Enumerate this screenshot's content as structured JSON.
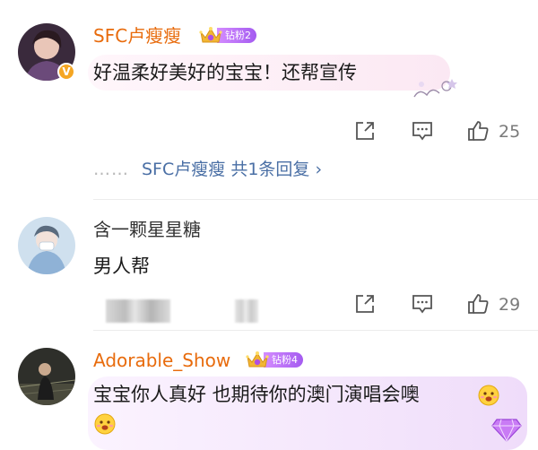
{
  "comments": [
    {
      "username": "SFC卢瘦瘦",
      "badge_label": "钻粉2",
      "text": "好温柔好美好的宝宝！还帮宣传",
      "likes": "25",
      "reply_user": "SFC卢瘦瘦",
      "reply_summary": "共1条回复",
      "reply_dots": "……",
      "reply_chevron": "›",
      "verified_mark": "V"
    },
    {
      "username": "含一颗星星糖",
      "text": "男人帮",
      "likes": "29"
    },
    {
      "username": "Adorable_Show",
      "badge_label": "钻粉4",
      "text": "宝宝你人真好 也期待你的澳门演唱会噢"
    }
  ],
  "icons": {
    "share": "share-icon",
    "comment": "comment-icon",
    "like": "thumbs-up-icon",
    "crown": "crown-icon"
  },
  "colors": {
    "username_highlight": "#e86b0c",
    "reply_link": "#4a6fa5",
    "badge_purple": "#a45bf0",
    "verified": "#f5a623"
  }
}
